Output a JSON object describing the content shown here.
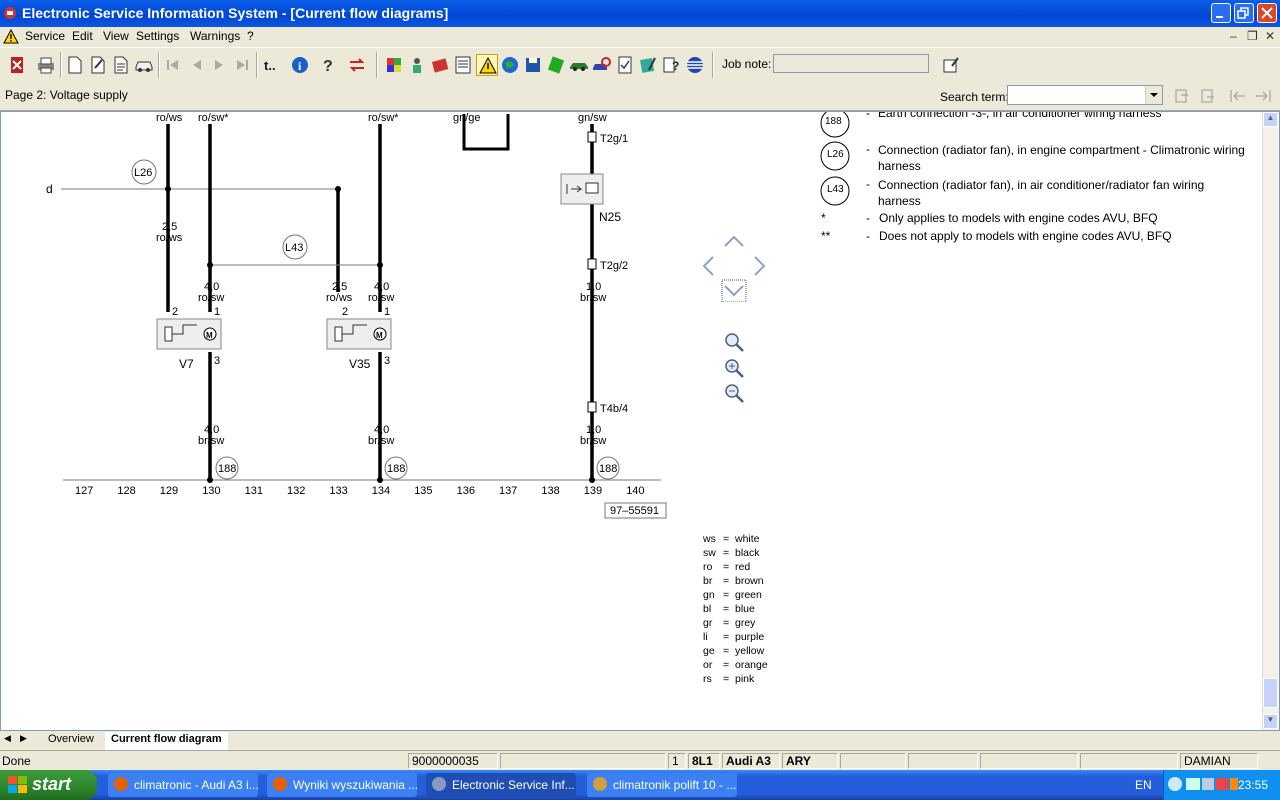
{
  "window": {
    "title": "Electronic Service Information System - [Current flow diagrams]"
  },
  "menu": [
    "Service",
    "Edit",
    "View",
    "Settings",
    "Warnings",
    "?"
  ],
  "toolbar": {
    "job_note_label": "Job note:",
    "job_note_value": "",
    "icons": [
      "exit-icon",
      "print-icon",
      "new-doc-icon",
      "edit-doc-icon",
      "document-icon",
      "car-icon",
      "first-icon",
      "prev-icon",
      "next-icon",
      "last-icon",
      "t-icon",
      "info-icon",
      "help-icon",
      "swap-icon",
      "colors-icon",
      "people-icon",
      "books-icon",
      "list-icon",
      "warning-icon",
      "globe-icon",
      "save-icon",
      "green-book-icon",
      "car2-icon",
      "search-car-icon",
      "checklist-icon",
      "notes-icon",
      "help2-icon",
      "flag-icon",
      "job-note-button-icon"
    ]
  },
  "page": {
    "title": "Page 2: Voltage supply",
    "search_label": "Search term:",
    "search_value": ""
  },
  "diagram": {
    "top_wire_labels": [
      "ro/ws",
      "ro/sw*",
      "ro/sw*",
      "gn/ge",
      "gn/sw"
    ],
    "connection_label_d": "d",
    "connections": [
      "L26",
      "L43"
    ],
    "wire_specs": {
      "w1": [
        "2,5",
        "ro/ws"
      ],
      "w2": [
        "4,0",
        "ro/sw"
      ],
      "w3": [
        "2,5",
        "ro/ws"
      ],
      "w4": [
        "4,0",
        "ro/sw"
      ],
      "w5": [
        "1,0",
        "br/sw"
      ],
      "b1": [
        "4,0",
        "br/sw"
      ],
      "b2": [
        "4,0",
        "br/sw"
      ],
      "b3": [
        "1,0",
        "br/sw"
      ]
    },
    "components": {
      "v7": "V7",
      "v35": "V35",
      "n25": "N25",
      "t2g1": "T2g/1",
      "t2g2": "T2g/2",
      "t4b4": "T4b/4"
    },
    "pins": {
      "p2": "2",
      "p1": "1",
      "p3": "3"
    },
    "earth_points": [
      "188",
      "188",
      "188"
    ],
    "track_numbers": [
      "127",
      "128",
      "129",
      "130",
      "131",
      "132",
      "133",
      "134",
      "135",
      "136",
      "137",
      "138",
      "139",
      "140"
    ],
    "diagram_id": "97–55591"
  },
  "legend": [
    {
      "symbol": "188",
      "dash": "-",
      "text": "Earth connection -3-, in air conditioner wiring harness"
    },
    {
      "symbol": "L26",
      "dash": "-",
      "text": "Connection (radiator fan), in engine compartment - Climatronic wiring harness"
    },
    {
      "symbol": "L43",
      "dash": "-",
      "text": "Connection (radiator fan), in air conditioner/radiator fan wiring harness"
    },
    {
      "symbol": "*",
      "dash": "-",
      "text": "Only applies to models with engine codes AVU, BFQ"
    },
    {
      "symbol": "**",
      "dash": "-",
      "text": "Does not apply to models with engine codes AVU, BFQ"
    }
  ],
  "color_codes": [
    {
      "code": "ws",
      "eq": "=",
      "name": "white"
    },
    {
      "code": "sw",
      "eq": "=",
      "name": "black"
    },
    {
      "code": "ro",
      "eq": "=",
      "name": "red"
    },
    {
      "code": "br",
      "eq": "=",
      "name": "brown"
    },
    {
      "code": "gn",
      "eq": "=",
      "name": "green"
    },
    {
      "code": "bl",
      "eq": "=",
      "name": "blue"
    },
    {
      "code": "gr",
      "eq": "=",
      "name": "grey"
    },
    {
      "code": "li",
      "eq": "=",
      "name": "purple"
    },
    {
      "code": "ge",
      "eq": "=",
      "name": "yellow"
    },
    {
      "code": "or",
      "eq": "=",
      "name": "orange"
    },
    {
      "code": "rs",
      "eq": "=",
      "name": "pink"
    }
  ],
  "tabs": [
    "Overview",
    "Current flow diagram"
  ],
  "status": {
    "state": "Done",
    "order_no": "9000000035",
    "num": "1",
    "model_code": "8L1",
    "model": "Audi A3",
    "engine": "ARY",
    "user": "DAMIAN"
  },
  "taskbar": {
    "start": "start",
    "tasks": [
      "climatronic - Audi A3 i...",
      "Wyniki wyszukiwania ...",
      "Electronic Service Inf...",
      "climatronik polift 10 - ..."
    ],
    "lang": "EN",
    "clock": "23:55"
  },
  "colors": {
    "titlebar": "#0046d5",
    "chrome": "#ece9d8",
    "taskbar": "#245edb",
    "start": "#2f8a2f"
  }
}
